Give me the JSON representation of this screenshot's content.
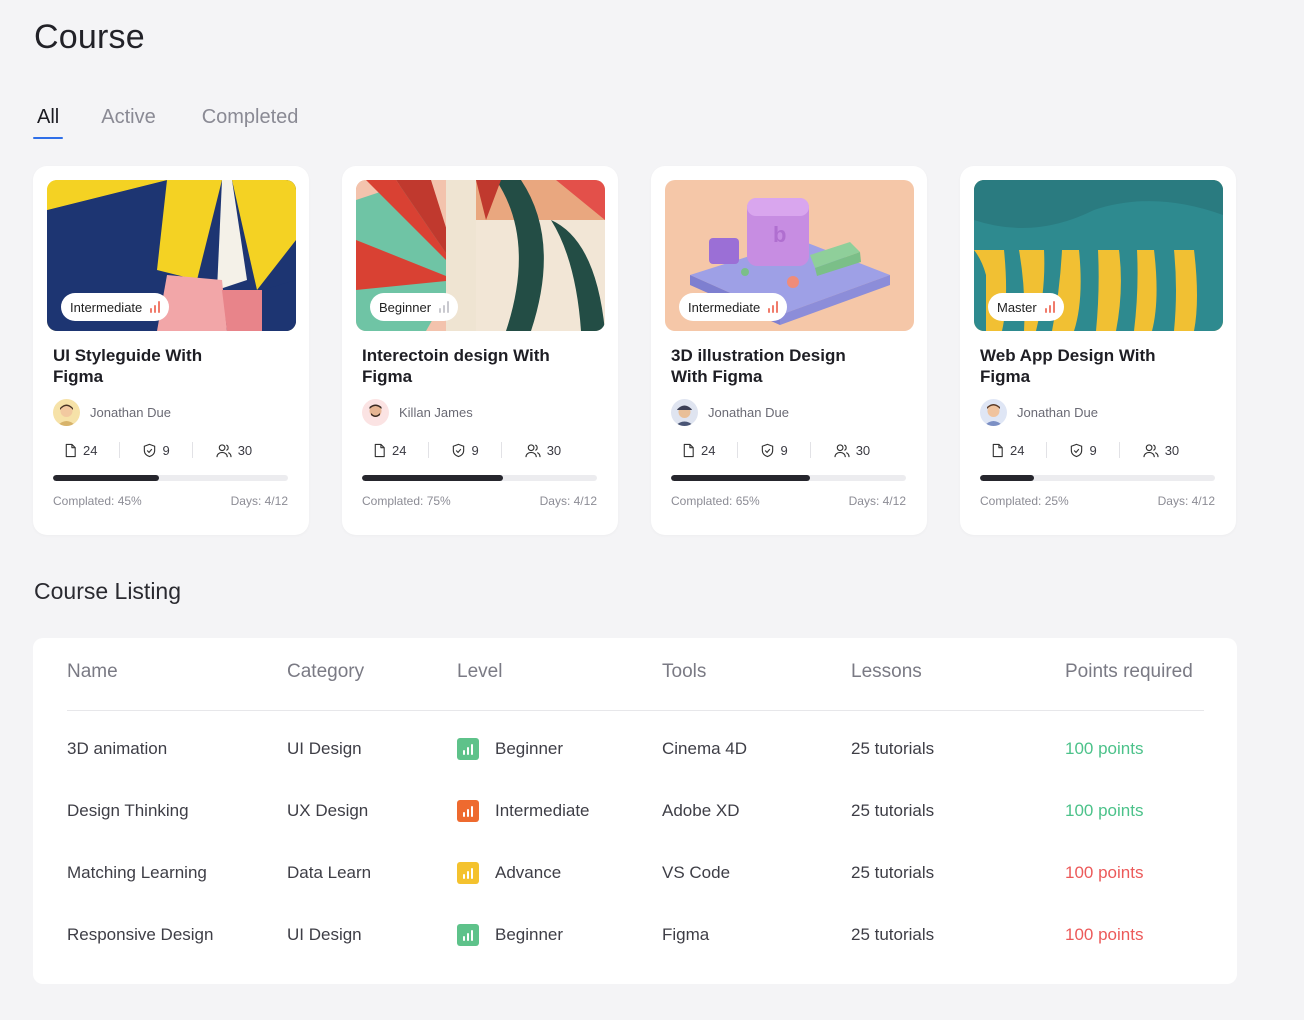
{
  "page": {
    "title": "Course"
  },
  "tabs": [
    {
      "label": "All",
      "active": true
    },
    {
      "label": "Active",
      "active": false
    },
    {
      "label": "Completed",
      "active": false
    }
  ],
  "cards": [
    {
      "level": "Intermediate",
      "title": "UI Styleguide With Figma",
      "author": "Jonathan Due",
      "files": "24",
      "badges": "9",
      "students": "30",
      "progress_label": "Complated: 45%",
      "progress": 0.45,
      "days": "Days: 4/12",
      "avatar_bg": "#f6e2a8"
    },
    {
      "level": "Beginner",
      "title": "Interectoin design With Figma",
      "author": "Killan James",
      "files": "24",
      "badges": "9",
      "students": "30",
      "progress_label": "Complated: 75%",
      "progress": 0.6,
      "days": "Days: 4/12",
      "avatar_bg": "#fbe3e3"
    },
    {
      "level": "Intermediate",
      "title": "3D illustration Design With Figma",
      "author": "Jonathan Due",
      "files": "24",
      "badges": "9",
      "students": "30",
      "progress_label": "Complated: 65%",
      "progress": 0.59,
      "days": "Days: 4/12",
      "avatar_bg": "#dfe4f0"
    },
    {
      "level": "Master",
      "title": "Web App Design With Figma",
      "author": "Jonathan Due",
      "files": "24",
      "badges": "9",
      "students": "30",
      "progress_label": "Complated: 25%",
      "progress": 0.23,
      "days": "Days: 4/12",
      "avatar_bg": "#dfe6f5"
    }
  ],
  "listing": {
    "title": "Course Listing",
    "headers": {
      "name": "Name",
      "category": "Category",
      "level": "Level",
      "tools": "Tools",
      "lessons": "Lessons",
      "points": "Points required"
    },
    "rows": [
      {
        "name": "3D animation",
        "category": "UI Design",
        "level": "Beginner",
        "level_color": "#5ec28a",
        "tools": "Cinema 4D",
        "lessons": "25 tutorials",
        "points": "100 points",
        "points_color": "#4cc28a"
      },
      {
        "name": "Design Thinking",
        "category": "UX Design",
        "level": "Intermediate",
        "level_color": "#ee6a2f",
        "tools": "Adobe XD",
        "lessons": "25 tutorials",
        "points": "100 points",
        "points_color": "#4cc28a"
      },
      {
        "name": "Matching Learning",
        "category": "Data Learn",
        "level": "Advance",
        "level_color": "#f4c22e",
        "tools": "VS Code",
        "lessons": "25 tutorials",
        "points": "100 points",
        "points_color": "#ec5a5a"
      },
      {
        "name": "Responsive Design",
        "category": "UI Design",
        "level": "Beginner",
        "level_color": "#5ec28a",
        "tools": "Figma",
        "lessons": "25 tutorials",
        "points": "100 points",
        "points_color": "#ec5a5a"
      }
    ]
  },
  "colors": {
    "accent": "#2f6fe8",
    "progress": "#26262d"
  }
}
